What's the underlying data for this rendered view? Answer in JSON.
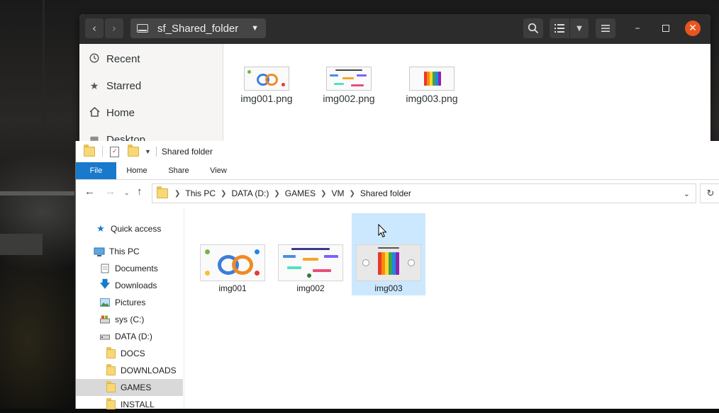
{
  "ubuntu_window": {
    "path_label": "sf_Shared_folder",
    "back_icon": "chevron-left-icon",
    "forward_icon": "chevron-right-icon",
    "sidebar": [
      {
        "label": "Recent",
        "icon": "clock-icon"
      },
      {
        "label": "Starred",
        "icon": "star-icon"
      },
      {
        "label": "Home",
        "icon": "home-icon"
      },
      {
        "label": "Desktop",
        "icon": "desktop-icon"
      }
    ],
    "files": [
      {
        "name": "img001.png"
      },
      {
        "name": "img002.png"
      },
      {
        "name": "img003.png"
      }
    ],
    "accent_color": "#e95420"
  },
  "explorer_window": {
    "title": "Shared folder",
    "ribbon_tabs": [
      "File",
      "Home",
      "Share",
      "View"
    ],
    "breadcrumb": [
      "This PC",
      "DATA (D:)",
      "GAMES",
      "VM",
      "Shared folder"
    ],
    "nav_tree": [
      {
        "label": "Quick access",
        "icon": "star-icon"
      },
      {
        "label": "This PC",
        "icon": "computer-icon"
      },
      {
        "label": "Documents",
        "icon": "document-icon"
      },
      {
        "label": "Downloads",
        "icon": "download-arrow-icon"
      },
      {
        "label": "Pictures",
        "icon": "picture-icon"
      },
      {
        "label": "sys (C:)",
        "icon": "drive-icon"
      },
      {
        "label": "DATA (D:)",
        "icon": "drive-icon"
      },
      {
        "label": "DOCS",
        "icon": "folder-icon"
      },
      {
        "label": "DOWNLOADS",
        "icon": "folder-icon"
      },
      {
        "label": "GAMES",
        "icon": "folder-icon"
      },
      {
        "label": "INSTALL",
        "icon": "folder-icon"
      }
    ],
    "selected_tree_item": "GAMES",
    "files": [
      {
        "name": "img001"
      },
      {
        "name": "img002"
      },
      {
        "name": "img003"
      }
    ],
    "selected_file": "img003",
    "accent_color": "#1979ca"
  }
}
